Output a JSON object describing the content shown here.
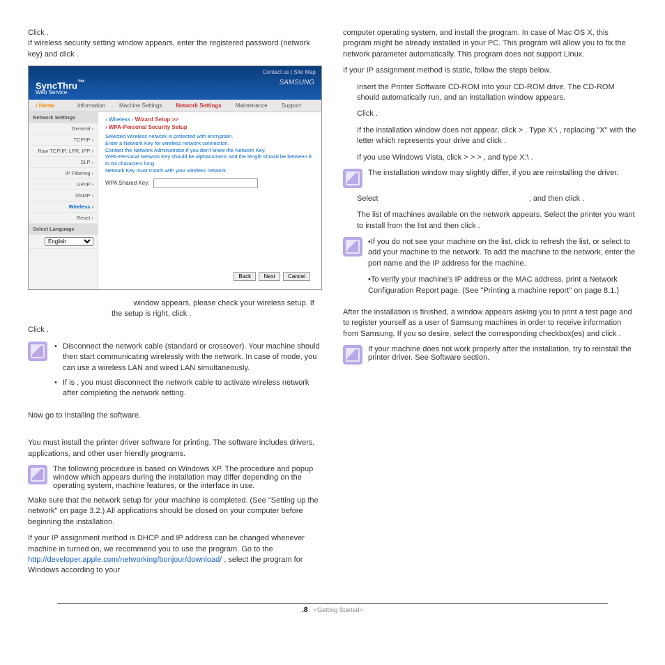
{
  "left": {
    "intro1a": "Click ",
    "intro1b": ".",
    "intro2a": "If wireless security setting window appears, enter the registered password (network key) and click ",
    "intro2b": ".",
    "afterShot1a": " window appears, please check your wireless setup. If the setup is right, click ",
    "afterShot1b": ".",
    "click2": "Click ",
    "click2b": ".",
    "bul1": "Disconnect the network cable (standard or crossover). Your machine should then start communicating wirelessly with the network. In case of           mode, you can use a wireless LAN and wired LAN simultaneously.",
    "bul2": "If                     is                    , you must disconnect the network cable to activate wireless network after completing the network setting.",
    "nowgo": "Now go to Installing the software.",
    "installHeading": "",
    "mustInstall": "You must install the printer driver software for printing. The software includes drivers, applications, and other user friendly programs.",
    "note1": "The following procedure is based on Windows XP. The procedure and popup window which appears during the installation may differ depending on the operating system, machine features, or the interface in use.",
    "makeSure": "Make sure that the network setup for your machine is completed. (See \"Setting up the network\" on page 3.2.) All applications should be closed on your computer before beginning the installation.",
    "dhcp1": "If your IP assignment method is DHCP and IP address can be changed whenever machine in turned on, we recommend you to use the            program. Go to the ",
    "dhcpLink": "http://developer.apple.com/networking/bonjour/download/",
    "dhcp2": ", select the program              for Windows according to your"
  },
  "right": {
    "topPara": "computer operating system, and install the program. In case of Mac OS X, this program might be already installed in your PC. This program will allow you to fix the network parameter automatically. This            program does not support Linux.",
    "staticIntro": "If your IP assignment method is static, follow the steps below.",
    "step1": "Insert the Printer Software CD-ROM into your CD-ROM drive. The CD-ROM should automatically run, and an installation window appears.",
    "step2": "Click        .",
    "step2b": "If the installation window does not appear, click           >         . Type X:\\               , replacing \"X\" with the letter which represents your drive and click       .",
    "step2c": "If you use Windows Vista, click           >                       >                     >        , and type X:\\               .",
    "note2": "The installation window may slightly differ, if you are reinstalling the driver.",
    "step3a": "Select ",
    "step3b": ", and then click       .",
    "step4": "The list of machines available on the network appears. Select the printer you want to install from the list and then click         .",
    "note3a": "•If you do not see your machine on the list, click              to refresh the list, or select                              to add your machine to the network. To add the machine to the network, enter the port name and the IP address for the machine.",
    "note3b": "•To verify your machine's IP address or the MAC address, print a Network Configuration Report page. (See \"Printing a machine report\" on page 8.1.)",
    "step5": "After the installation is finished, a window appears asking you to print a test page and to register yourself as a user of Samsung machines in order to receive information from Samsung. If you so desire, select the corresponding checkbox(es) and click           .",
    "note4": "If your machine does not work properly after the installation, try to reinstall the printer driver. See Software section."
  },
  "screenshot": {
    "toplinks": "Contact us   |   Site Map",
    "brand": "SAMSUNG",
    "logo": "SyncThru",
    "logoSub": "Web Service",
    "tabs": {
      "home": "› Home",
      "info": "Information",
      "machine": "Machine Settings",
      "network": "Network Settings",
      "maint": "Maintenance",
      "support": "Support"
    },
    "side": {
      "hdr": "Network Settings",
      "items": [
        "General ›",
        "TCP/IP ›",
        "Raw TCP/IP, LPR, IPP ›",
        "SLP ›",
        "IP Filtering ›",
        "UPnP ›",
        "SNMP ›",
        "Wireless ›",
        "Reset ›"
      ],
      "langHdr": "Select Language",
      "langVal": "English"
    },
    "main": {
      "crumb1": "› Wireless › ",
      "crumb2": "Wizard Setup >>",
      "sub": "› WPA-Personal Security Setup",
      "desc": "Selected Wireless network is protected with encryption.\nEnter a Network Key for wireless network connection.\nContact the Network Administrator if you don't know the Network Key.\nWPA-Personal Network Key should be alphanumeric and the length should be between 8 to 63 characters long.\nNetwork Key must match with your wireless network.",
      "fieldLabel": "WPA Shared Key:",
      "btnBack": "Back",
      "btnNext": "Next",
      "btnCancel": "Cancel"
    }
  },
  "footer": {
    "page": ".8",
    "section": "<Getting Started>"
  }
}
